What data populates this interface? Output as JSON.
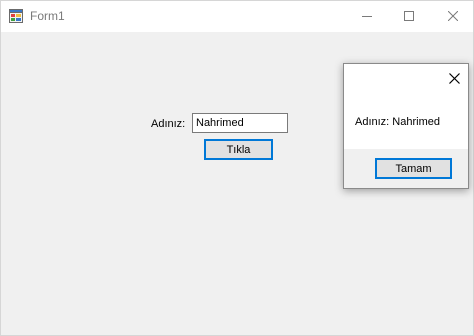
{
  "window": {
    "title": "Form1"
  },
  "form": {
    "name_label": "Adınız:",
    "name_value": "Nahrimed",
    "button_label": "Tıkla"
  },
  "messagebox": {
    "message": "Adınız: Nahrimed",
    "ok_label": "Tamam"
  },
  "icons": {
    "app": "windows-form-icon",
    "minimize": "minimize-icon",
    "maximize": "maximize-icon",
    "close": "close-icon",
    "dialog_close": "close-icon"
  },
  "colors": {
    "focus_accent": "#0078d7",
    "window_bg": "#f0f0f0",
    "titlebar_bg": "#ffffff"
  }
}
